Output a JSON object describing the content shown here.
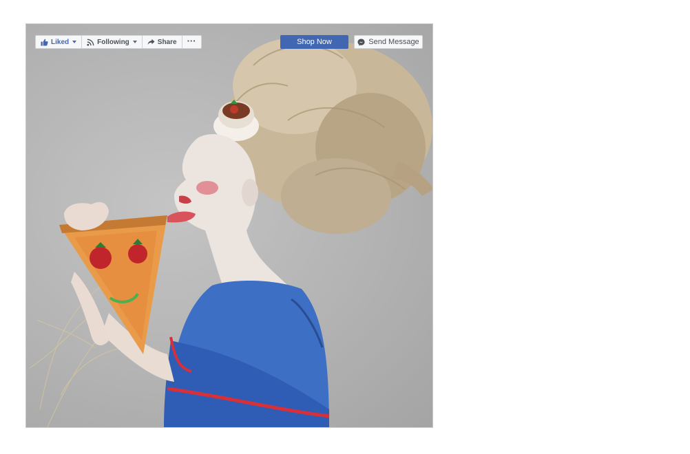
{
  "toolbar": {
    "liked_label": "Liked",
    "following_label": "Following",
    "share_label": "Share",
    "more_label": "···"
  },
  "actions": {
    "shop_label": "Shop Now",
    "message_label": "Send Message"
  },
  "colors": {
    "brand_blue": "#4267b2",
    "button_bg": "#f6f7f9",
    "button_border": "#ced0d4",
    "button_text": "#4b4f56"
  },
  "icons": [
    "thumbs-up-icon",
    "rss-icon",
    "share-arrow-icon",
    "more-dots-icon",
    "messenger-icon"
  ]
}
